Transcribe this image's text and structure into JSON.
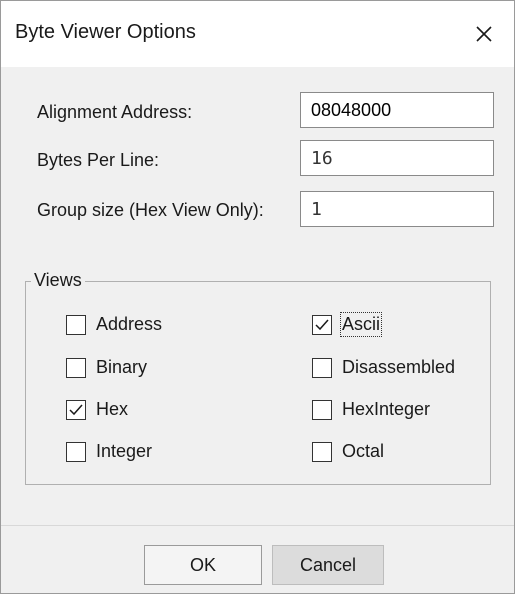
{
  "dialog": {
    "title": "Byte Viewer Options"
  },
  "fields": {
    "alignment_label": "Alignment Address:",
    "alignment_value": "08048000",
    "bytes_label": "Bytes Per Line:",
    "bytes_value": "16",
    "group_label": "Group size (Hex View Only):",
    "group_value": "1"
  },
  "views": {
    "legend": "Views",
    "items": [
      {
        "label": "Address",
        "checked": false
      },
      {
        "label": "Ascii",
        "checked": true
      },
      {
        "label": "Binary",
        "checked": false
      },
      {
        "label": "Disassembled",
        "checked": false
      },
      {
        "label": "Hex",
        "checked": true
      },
      {
        "label": "HexInteger",
        "checked": false
      },
      {
        "label": "Integer",
        "checked": false
      },
      {
        "label": "Octal",
        "checked": false
      }
    ]
  },
  "buttons": {
    "ok": "OK",
    "cancel": "Cancel"
  }
}
